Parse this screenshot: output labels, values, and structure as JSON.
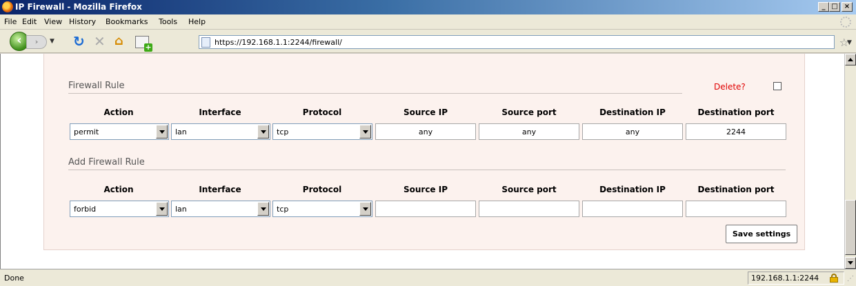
{
  "window": {
    "title": "IP Firewall - Mozilla Firefox",
    "minimize": "_",
    "maximize": "□",
    "close": "×"
  },
  "menu": [
    "File",
    "Edit",
    "View",
    "History",
    "Bookmarks",
    "Tools",
    "Help"
  ],
  "nav": {
    "url": "https://192.168.1.1:2244/firewall/",
    "star_icon": "☆"
  },
  "rule": {
    "section_title": "Firewall Rule",
    "delete_label": "Delete?",
    "delete_checked": false,
    "headers": [
      "Action",
      "Interface",
      "Protocol",
      "Source IP",
      "Source port",
      "Destination IP",
      "Destination port"
    ],
    "action": "permit",
    "interface": "lan",
    "protocol": "tcp",
    "source_ip": "any",
    "source_port": "any",
    "destination_ip": "any",
    "destination_port": "2244"
  },
  "add_rule": {
    "section_title": "Add Firewall Rule",
    "headers": [
      "Action",
      "Interface",
      "Protocol",
      "Source IP",
      "Source port",
      "Destination IP",
      "Destination port"
    ],
    "action": "forbid",
    "interface": "lan",
    "protocol": "tcp",
    "source_ip": "",
    "source_port": "",
    "destination_ip": "",
    "destination_port": ""
  },
  "save_label": "Save settings",
  "status": {
    "text": "Done",
    "host": "192.168.1.1:2244"
  },
  "icons": {
    "app": "firefox-icon",
    "reload": "reload-icon",
    "stop": "stop-icon",
    "home": "home-icon",
    "lock": "lock-icon"
  },
  "colors": {
    "panel_background": "#fcf2ee",
    "delete_label": "#e00000",
    "title_bar": "#0a246a"
  }
}
